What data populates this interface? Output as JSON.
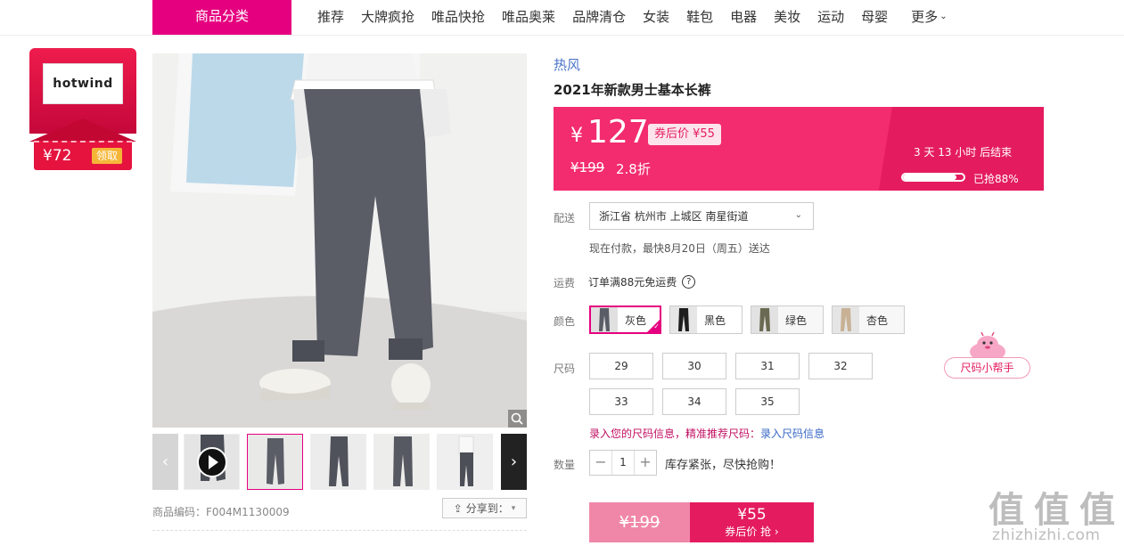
{
  "nav": {
    "category_label": "商品分类",
    "items": [
      "推荐",
      "大牌疯抢",
      "唯品快抢",
      "唯品奥莱",
      "品牌清仓",
      "女装",
      "鞋包",
      "电器",
      "美妆",
      "运动",
      "母婴"
    ],
    "more_label": "更多"
  },
  "coupon": {
    "logo_text": "hotwind",
    "amount": "¥72",
    "get_label": "领取"
  },
  "gallery": {
    "sku_code": "商品编码：F004M1130009",
    "share_label": "分享到："
  },
  "product": {
    "brand": "热风",
    "title": "2021年新款男士基本长裤",
    "currency": "¥",
    "price": "127",
    "coupon_price": "券后价 ¥55",
    "original_price": "¥199",
    "discount": "2.8折",
    "countdown": "3  天 13  小时 后结束",
    "sold_progress": 0.88,
    "sold_label": "已抢88%"
  },
  "delivery": {
    "label": "配送",
    "address": "浙江省 杭州市 上城区 南星街道",
    "eta": "现在付款，最快8月20日（周五）送达"
  },
  "shipping": {
    "label": "运费",
    "text": "订单满88元免运费",
    "help": "?"
  },
  "colors": {
    "label": "颜色",
    "options": [
      "灰色",
      "黑色",
      "绿色",
      "杏色"
    ],
    "selected": "灰色"
  },
  "sizes": {
    "label": "尺码",
    "options": [
      "29",
      "30",
      "31",
      "32",
      "33",
      "34",
      "35"
    ],
    "tip_prefix": "录入您的尺码信息，精准推荐尺码：",
    "tip_link": "录入尺码信息",
    "helper_label": "尺码小帮手"
  },
  "quantity": {
    "label": "数量",
    "value": "1",
    "minus": "−",
    "plus": "+",
    "stock_note": "库存紧张，尽快抢购！"
  },
  "buy": {
    "original_price": "¥199",
    "price": "¥55",
    "label": "券后价 抢 ›"
  },
  "watermark": {
    "chars": [
      "值",
      "值",
      "值"
    ],
    "url": "zhizhizhi.com"
  },
  "colors_theme": {
    "accent": "#e5007f",
    "price_red": "#e41c5f",
    "link_blue": "#4a74c9"
  }
}
